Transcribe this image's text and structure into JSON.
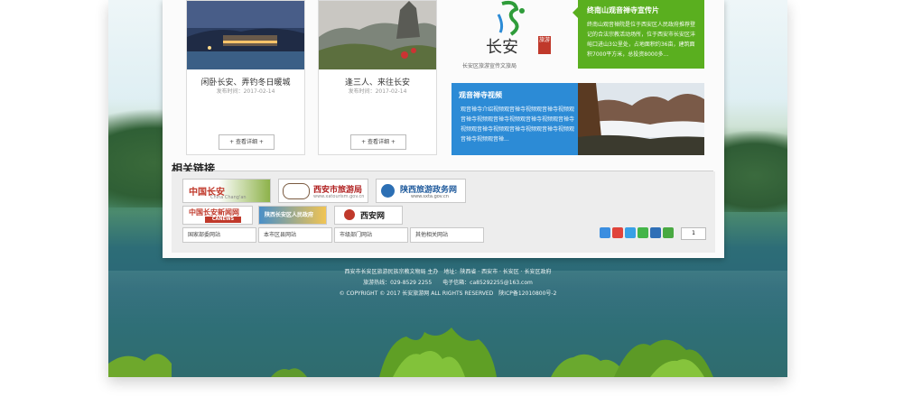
{
  "cards": [
    {
      "title": "闲卧长安、弄钓冬日暖城",
      "date": "发布时间：2017-02-14",
      "more": "+ 查看详细 +"
    },
    {
      "title": "逢三人、来往长安",
      "date": "发布时间：2017-02-14",
      "more": "+ 查看详细 +"
    }
  ],
  "logo": {
    "text": "长安",
    "seal": "旅游",
    "subtitle": "长安区旅游宣传文旅局"
  },
  "promo_green": {
    "title": "终南山观音禅寺宣传片",
    "text": "终南山观音禅院是位于西安区人民政府推荐登记的合法宗教活动场所，位于西安市长安区沣峪口进山3公里处，占地面积约36亩，建筑面积7000平方米，总投资8000多..."
  },
  "promo_blue": {
    "title": "观音禅寺视频",
    "text": "观音禅寺介绍视频观音禅寺视频观音禅寺视频观音禅寺视频观音禅寺视频观音禅寺视频观音禅寺视频观音禅寺视频观音禅寺视频观音禅寺视频观音禅寺视频观音禅..."
  },
  "links": {
    "title": "相关链接",
    "banners": [
      {
        "label": "中国长安",
        "sub": "China Chang'an"
      },
      {
        "label": "西安市旅游局",
        "sub": "www.xatourism.gov.cn"
      },
      {
        "label": "陕西旅游政务网",
        "sub": "www.sxta.gov.cn"
      },
      {
        "label": "中国长安新闻网",
        "sub": "CANEWS"
      },
      {
        "label": "陕西长安区人民政府",
        "sub": ""
      },
      {
        "label": "西安网",
        "sub": ""
      }
    ],
    "selects": [
      "国家部委网站",
      "本市区县网站",
      "市级部门网站",
      "其他相关网站"
    ],
    "share_count": "1"
  },
  "footer": {
    "line1": "西安市长安区旅游民族宗教文物局 主办　地址：陕西省 · 西安市 · 长安区 · 长安区政府",
    "line2": "旅游热线：029-8529 2255　　电子信箱：ca85292255@163.com",
    "line3": "© COPYRIGHT © 2017 长安旅游网 ALL RIGHTS RESERVED　陕ICP备12010800号-2"
  },
  "colors": {
    "green": "#5aaf1f",
    "blue": "#2c8bd6"
  }
}
